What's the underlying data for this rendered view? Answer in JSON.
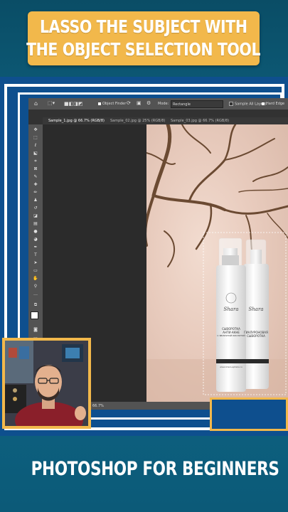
{
  "title": {
    "line1": "LASSO THE SUBJECT WITH",
    "line2": "THE OBJECT SELECTION TOOL"
  },
  "footer": {
    "text": "PHOTOSHOP FOR BEGINNERS"
  },
  "photoshop": {
    "options_bar": {
      "object_finder": "Object Finder",
      "mode_label": "Mode:",
      "mode_value": "Rectangle",
      "sample_all_layers": "Sample All Layers",
      "hard_edge": "Hard Edge"
    },
    "tabs": [
      {
        "label": "Sample_1.jpg @ 66.7% (RGB/8)",
        "active": true
      },
      {
        "label": "Sample_02.jpg @ 25% (RGB/8)",
        "active": false
      },
      {
        "label": "Sample_03.jpg @ 66.7% (RGB/8)",
        "active": false
      }
    ],
    "status": {
      "zoom": "66.7%"
    },
    "product": {
      "brand": "Shara",
      "bottle1_line1": "СЫВОРОТКА",
      "bottle1_line2": "АНТИ-АКНЕ",
      "bottle1_line3": "С ЯБЛОЧНОЙ КИСЛОТОЙ",
      "bottle2_line1": "ГИАЛУРОНОВАЯ",
      "bottle2_line2": "СЫВОРОТКА",
      "url": "www.shara-apteka.ru"
    }
  },
  "colors": {
    "accent_yellow": "#f2b84b",
    "frame_blue": "#0e4f8e",
    "background_teal": "#0d5673"
  }
}
